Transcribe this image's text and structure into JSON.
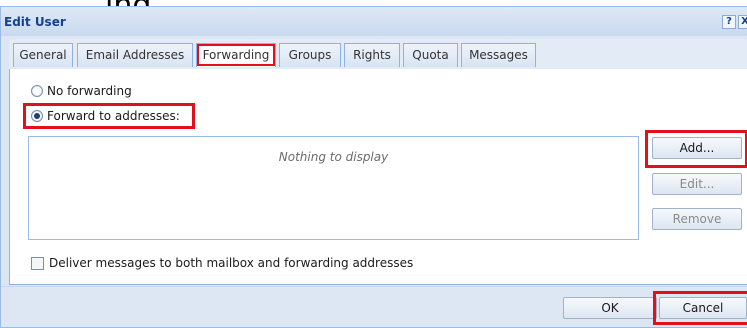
{
  "dialog": {
    "title": "Edit User",
    "tools": {
      "help": "?",
      "close": "X"
    }
  },
  "background_text": "ing",
  "tabs": [
    {
      "label": "General",
      "active": false
    },
    {
      "label": "Email Addresses",
      "active": false
    },
    {
      "label": "Forwarding",
      "active": true
    },
    {
      "label": "Groups",
      "active": false
    },
    {
      "label": "Rights",
      "active": false
    },
    {
      "label": "Quota",
      "active": false
    },
    {
      "label": "Messages",
      "active": false
    }
  ],
  "forwarding": {
    "no_forwarding": {
      "label": "No forwarding",
      "selected": false
    },
    "forward_to": {
      "label": "Forward to addresses:",
      "selected": true
    },
    "grid_empty_text": "Nothing to display",
    "buttons": {
      "add": "Add...",
      "edit": "Edit...",
      "remove": "Remove"
    },
    "deliver_both": {
      "label": "Deliver messages to both mailbox and forwarding addresses",
      "checked": false
    }
  },
  "footer": {
    "ok": "OK",
    "cancel": "Cancel"
  },
  "colors": {
    "highlight": "#e0101d",
    "title_text": "#15428b",
    "window_bg": "#dce7f3"
  }
}
